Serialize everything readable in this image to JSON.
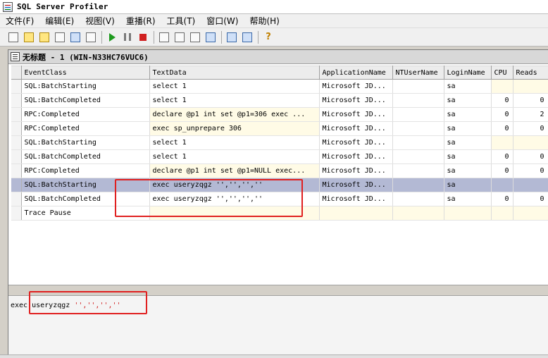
{
  "window": {
    "title": "SQL Server Profiler"
  },
  "menu": [
    {
      "label": "文件(F)"
    },
    {
      "label": "编辑(E)"
    },
    {
      "label": "视图(V)"
    },
    {
      "label": "重播(R)"
    },
    {
      "label": "工具(T)"
    },
    {
      "label": "窗口(W)"
    },
    {
      "label": "帮助(H)"
    }
  ],
  "toolbar": {
    "icons": [
      "new-trace-icon",
      "new-template-icon",
      "open-icon",
      "properties-icon",
      "find-icon",
      "clear-icon",
      "run-icon",
      "pause-icon",
      "stop-icon",
      "windows-icon",
      "align-icon",
      "template-icon",
      "scroll-icon",
      "tools-icon",
      "perfmon-icon",
      "help-icon"
    ]
  },
  "trace": {
    "title": "无标题 - 1 (WIN-N33HC76VUC6)",
    "columns": [
      "EventClass",
      "TextData",
      "ApplicationName",
      "NTUserName",
      "LoginName",
      "CPU",
      "Reads"
    ],
    "rows": [
      {
        "event": "SQL:BatchStarting",
        "text": "select 1",
        "app": "Microsoft JD...",
        "nt": "",
        "login": "sa",
        "cpu": "",
        "reads": ""
      },
      {
        "event": "SQL:BatchCompleted",
        "text": "select 1",
        "app": "Microsoft JD...",
        "nt": "",
        "login": "sa",
        "cpu": "0",
        "reads": "0"
      },
      {
        "event": "RPC:Completed",
        "text": "declare @p1 int  set @p1=306  exec ...",
        "app": "Microsoft JD...",
        "nt": "",
        "login": "sa",
        "cpu": "0",
        "reads": "2"
      },
      {
        "event": "RPC:Completed",
        "text": "exec sp_unprepare 306",
        "app": "Microsoft JD...",
        "nt": "",
        "login": "sa",
        "cpu": "0",
        "reads": "0"
      },
      {
        "event": "SQL:BatchStarting",
        "text": "select 1",
        "app": "Microsoft JD...",
        "nt": "",
        "login": "sa",
        "cpu": "",
        "reads": ""
      },
      {
        "event": "SQL:BatchCompleted",
        "text": "select 1",
        "app": "Microsoft JD...",
        "nt": "",
        "login": "sa",
        "cpu": "0",
        "reads": "0"
      },
      {
        "event": "RPC:Completed",
        "text": "declare @p1 int  set @p1=NULL  exec...",
        "app": "Microsoft JD...",
        "nt": "",
        "login": "sa",
        "cpu": "0",
        "reads": "0"
      },
      {
        "event": "SQL:BatchStarting",
        "text": "exec useryzqgz '','','',''",
        "app": "Microsoft JD...",
        "nt": "",
        "login": "sa",
        "cpu": "",
        "reads": ""
      },
      {
        "event": "SQL:BatchCompleted",
        "text": "exec useryzqgz '','','',''",
        "app": "Microsoft JD...",
        "nt": "",
        "login": "sa",
        "cpu": "0",
        "reads": "0"
      },
      {
        "event": "Trace Pause",
        "text": "",
        "app": "",
        "nt": "",
        "login": "",
        "cpu": "",
        "reads": ""
      }
    ],
    "selected_row": 7
  },
  "detail": {
    "keyword": "exec useryzqgz",
    "args": "'','','',''"
  },
  "colors": {
    "selection": "#b3b9d4",
    "annotation": "#e02020",
    "string": "#d01818"
  }
}
